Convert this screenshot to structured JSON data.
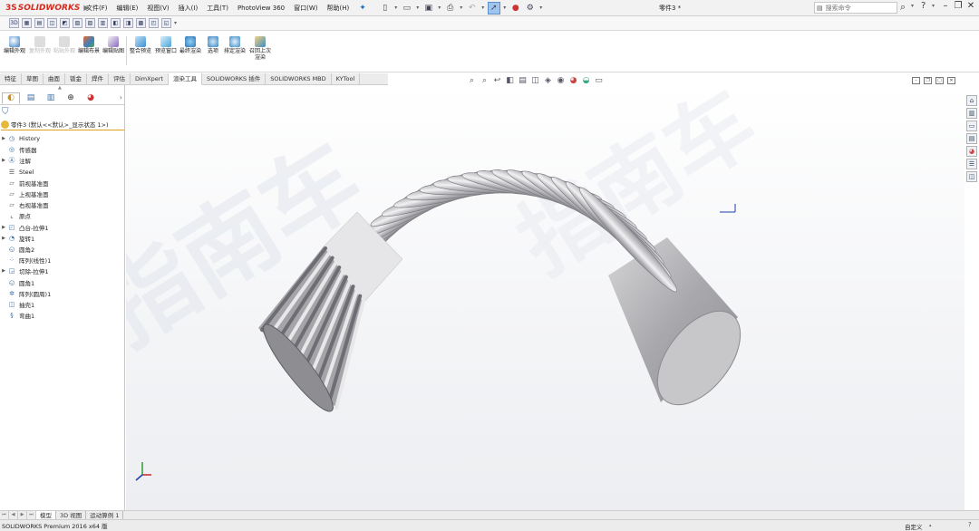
{
  "app": {
    "logo_text": "SOLIDWORKS",
    "logo_prefix": "3S",
    "document_title": "零件3 *",
    "search_placeholder": "搜索命令"
  },
  "menus": [
    "文件(F)",
    "编辑(E)",
    "视图(V)",
    "插入(I)",
    "工具(T)",
    "PhotoView 360",
    "窗口(W)",
    "帮助(H)"
  ],
  "command_manager": [
    {
      "label": "编辑外观",
      "icon": "edit-appearance-icon",
      "color": "#3a7fc4",
      "enabled": true
    },
    {
      "label": "复制外观",
      "icon": "copy-appearance-icon",
      "color": "#cccccc",
      "enabled": false
    },
    {
      "label": "粘贴外观",
      "icon": "paste-appearance-icon",
      "color": "#cccccc",
      "enabled": false
    },
    {
      "label": "编辑布景",
      "icon": "edit-scene-icon",
      "color": "#d1642f",
      "enabled": true
    },
    {
      "label": "编辑贴图",
      "icon": "edit-decal-icon",
      "color": "#8a6bbf",
      "enabled": true
    },
    {
      "label": "整合预览",
      "icon": "integrated-preview-icon",
      "color": "#3d8fd1",
      "enabled": true
    },
    {
      "label": "预览窗口",
      "icon": "preview-window-icon",
      "color": "#4aa5d8",
      "enabled": true
    },
    {
      "label": "最终渲染",
      "icon": "final-render-icon",
      "color": "#2f77b5",
      "enabled": true
    },
    {
      "label": "选项",
      "icon": "options-icon",
      "color": "#3a84c2",
      "enabled": true
    },
    {
      "label": "排定渲染",
      "icon": "schedule-render-icon",
      "color": "#3b8dc7",
      "enabled": true
    },
    {
      "label": "召回上次渲染",
      "icon": "recall-render-icon",
      "color": "#e3a52a",
      "enabled": true
    }
  ],
  "tabs": [
    "特征",
    "草图",
    "曲面",
    "钣金",
    "焊件",
    "评估",
    "DimXpert",
    "渲染工具",
    "SOLIDWORKS 插件",
    "SOLIDWORKS MBD",
    "KYTool"
  ],
  "active_tab": "渲染工具",
  "feature_tree": {
    "root": "零件3 (默认<<默认>_显示状态 1>)",
    "items": [
      {
        "label": "History",
        "icon": "history-icon",
        "expand": true
      },
      {
        "label": "传感器",
        "icon": "sensor-icon",
        "expand": false
      },
      {
        "label": "注解",
        "icon": "annotation-icon",
        "expand": true
      },
      {
        "label": "Steel",
        "icon": "material-icon",
        "expand": false
      },
      {
        "label": "前视基准面",
        "icon": "plane-icon",
        "expand": false
      },
      {
        "label": "上视基准面",
        "icon": "plane-icon",
        "expand": false
      },
      {
        "label": "右视基准面",
        "icon": "plane-icon",
        "expand": false
      },
      {
        "label": "原点",
        "icon": "origin-icon",
        "expand": false
      },
      {
        "label": "凸台-拉伸1",
        "icon": "extrude-icon",
        "expand": true
      },
      {
        "label": "旋转1",
        "icon": "revolve-icon",
        "expand": true
      },
      {
        "label": "圆角2",
        "icon": "fillet-icon",
        "expand": false
      },
      {
        "label": "阵列(线性)1",
        "icon": "linear-pattern-icon",
        "expand": false
      },
      {
        "label": "切除-拉伸1",
        "icon": "cut-extrude-icon",
        "expand": true
      },
      {
        "label": "圆角1",
        "icon": "fillet-icon",
        "expand": false
      },
      {
        "label": "阵列(圆周)1",
        "icon": "circular-pattern-icon",
        "expand": false
      },
      {
        "label": "抽壳1",
        "icon": "shell-icon",
        "expand": false
      },
      {
        "label": "弯曲1",
        "icon": "flex-icon",
        "expand": false
      }
    ]
  },
  "bottom_tabs": [
    "模型",
    "3D 视图",
    "运动算例 1"
  ],
  "active_bottom_tab": "模型",
  "status": {
    "version": "SOLIDWORKS Premium 2016 x64 版",
    "custom": "自定义"
  },
  "watermark": "指南车",
  "colors": {
    "brand": "#d52b1e",
    "selection": "#9fc5ee",
    "model_body": "#b9b9bc"
  }
}
